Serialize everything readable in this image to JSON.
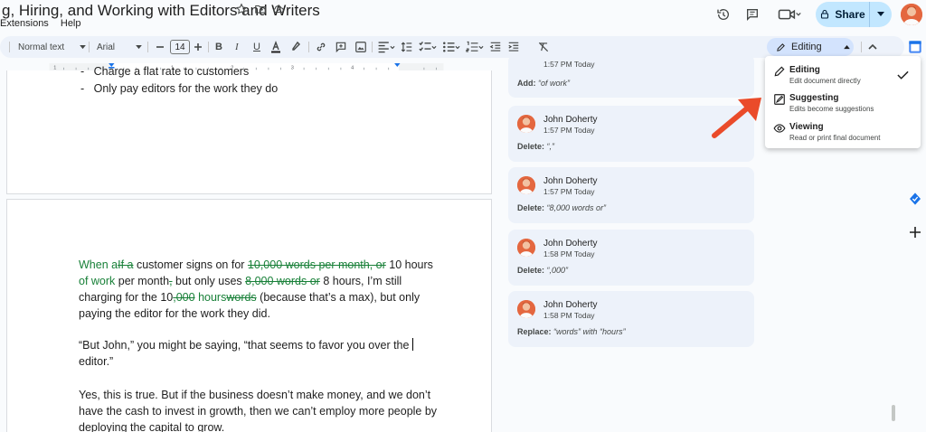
{
  "header": {
    "title": "g, Hiring, and Working with Editors and Writers",
    "menus": [
      "Extensions",
      "Help"
    ],
    "share_label": "Share"
  },
  "toolbar": {
    "style": "Normal text",
    "font": "Arial",
    "font_size": "14",
    "mode_label": "Editing"
  },
  "document": {
    "page1_lines": [
      "Charge a flat rate to customers",
      "Only pay editors for the work they do"
    ],
    "page2": {
      "p1_l1_a": "When a",
      "p1_l1_del1": "If a",
      "p1_l1_b": " customer signs on for ",
      "p1_l1_del2": "10,000 words per month, or",
      "p1_l1_c": " 10 hours",
      "p1_l2_ins": "of work",
      "p1_l2_a": " per month",
      "p1_l2_del": ",",
      "p1_l2_b": " but only uses ",
      "p1_l2_del2": "8,000 words or",
      "p1_l2_c": " 8 hours, I’m still",
      "p1_l3_a": "charging for the 10",
      "p1_l3_del": ",000",
      "p1_l3_ins": " hours",
      "p1_l3_del2": "words",
      "p1_l3_b": " (because that’s a max), but only",
      "p1_l4": "paying the editor for the work they did.",
      "p2_l1": "“But John,” you might be saying, “that seems to favor you over the ",
      "p2_l2": "editor.”",
      "p3_l1": "Yes, this is true. But if the business doesn’t make money, and we don’t",
      "p3_l2": "have the cash to invest in growth, then we can’t employ more people by",
      "p3_l3": "deploying the capital to grow."
    }
  },
  "comments": [
    {
      "name": "",
      "time": "1:57 PM Today",
      "action_label": "Add:",
      "action_text": "“of work”"
    },
    {
      "name": "John Doherty",
      "time": "1:57 PM Today",
      "action_label": "Delete:",
      "action_text": "“,”"
    },
    {
      "name": "John Doherty",
      "time": "1:57 PM Today",
      "action_label": "Delete:",
      "action_text": "“8,000 words or”"
    },
    {
      "name": "John Doherty",
      "time": "1:58 PM Today",
      "action_label": "Delete:",
      "action_text": "“,000”"
    },
    {
      "name": "John Doherty",
      "time": "1:58 PM Today",
      "action_label": "Replace:",
      "action_text": "“words” with “hours”"
    }
  ],
  "mode_menu": {
    "items": [
      {
        "title": "Editing",
        "sub": "Edit document directly"
      },
      {
        "title": "Suggesting",
        "sub": "Edits become suggestions"
      },
      {
        "title": "Viewing",
        "sub": "Read or print final document"
      }
    ]
  },
  "colors": {
    "accent": "#c2e7ff",
    "suggestion": "#188038",
    "arrow": "#ea4b2a"
  }
}
